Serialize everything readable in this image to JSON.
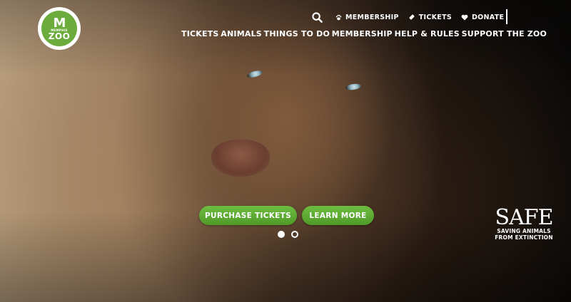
{
  "logo": {
    "top_text": "MEMPHIS",
    "main_text": "ZOO",
    "monogram": "M",
    "brand_color": "#6cac3c"
  },
  "utility_nav": {
    "search_icon": "search-icon",
    "items": [
      {
        "label": "MEMBERSHIP",
        "icon": "paw-icon"
      },
      {
        "label": "TICKETS",
        "icon": "ticket-icon"
      },
      {
        "label": "DONATE",
        "icon": "heart-icon"
      }
    ]
  },
  "main_nav": {
    "items": [
      "TICKETS",
      "ANIMALS",
      "THINGS TO DO",
      "MEMBERSHIP",
      "HELP & RULES",
      "SUPPORT THE ZOO"
    ]
  },
  "hero": {
    "cta_primary": "PURCHASE TICKETS",
    "cta_secondary": "LEARN MORE",
    "button_color": "#5aa832",
    "slides_total": 2,
    "slide_active": 1
  },
  "safe_badge": {
    "wordmark": "SAFE",
    "line1": "SAVING ANIMALS",
    "line2": "FROM EXTINCTION"
  }
}
